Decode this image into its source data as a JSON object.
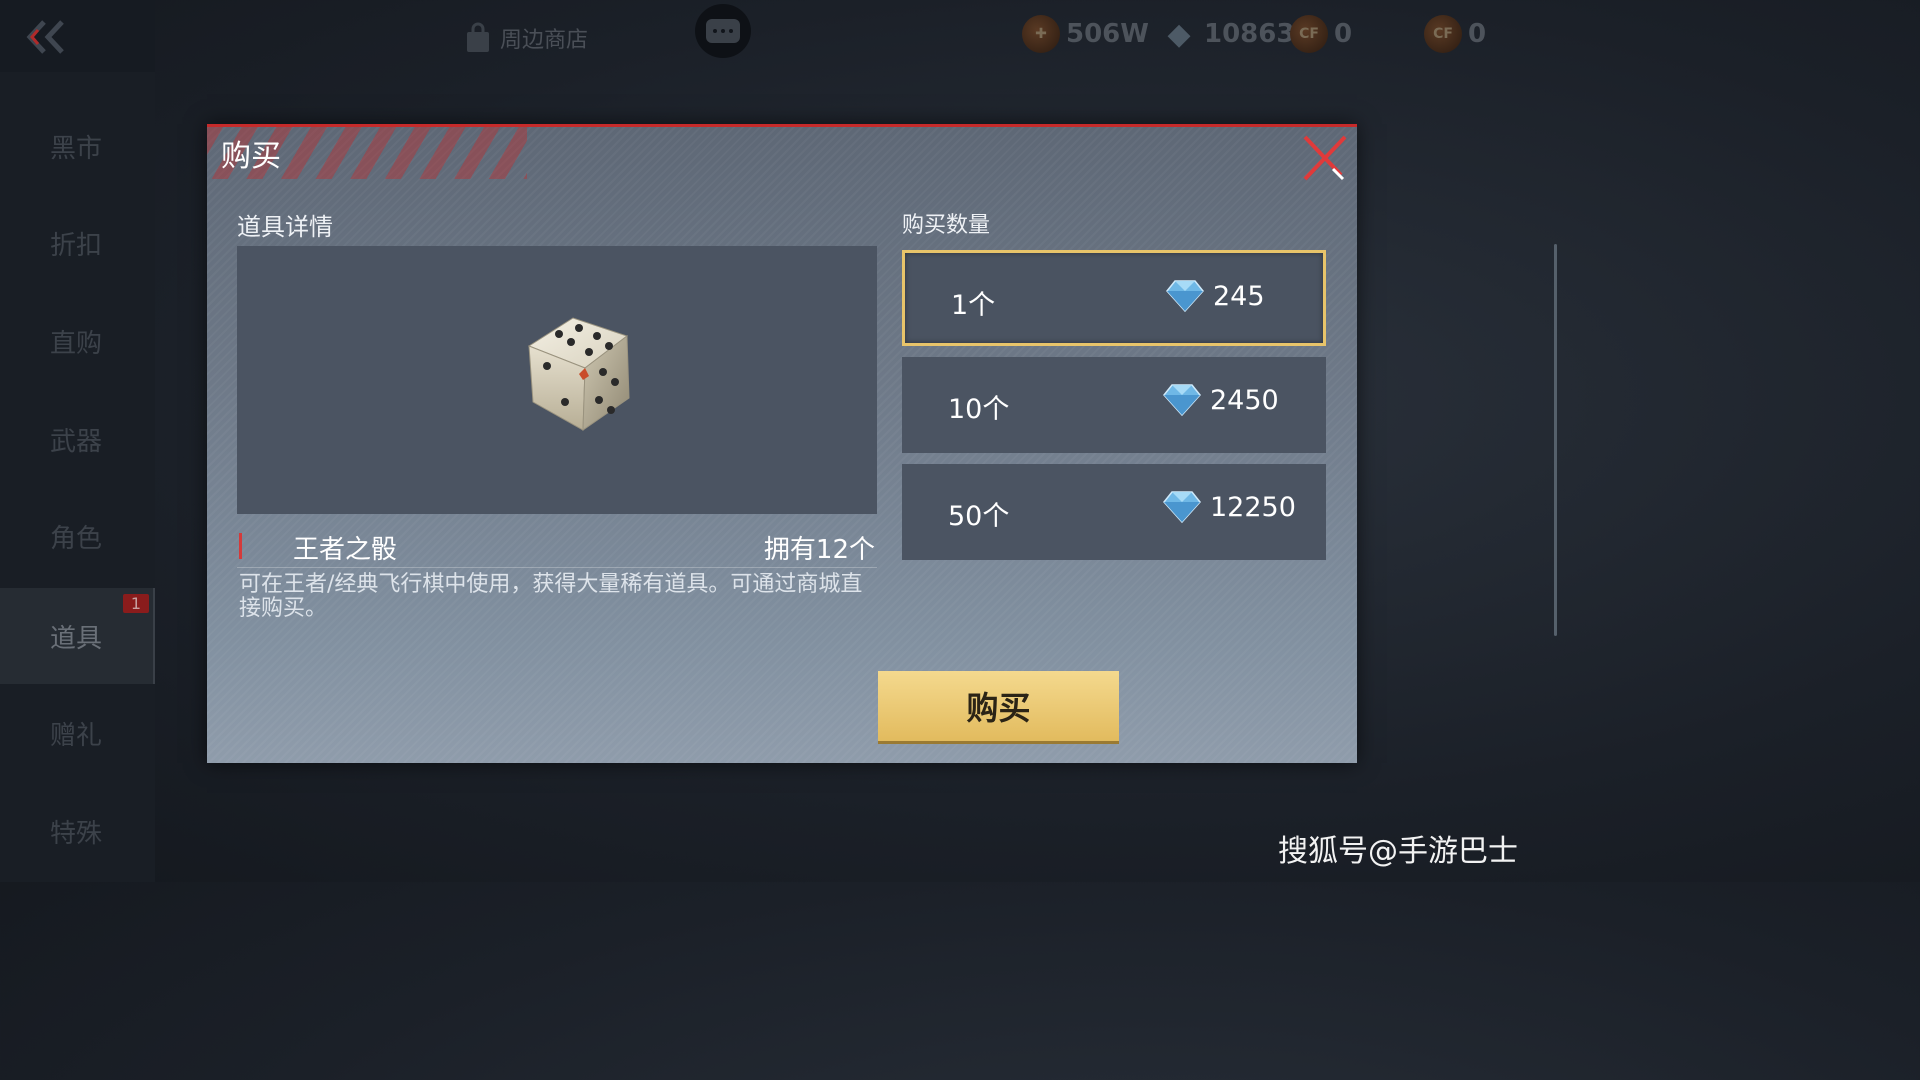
{
  "topbar": {
    "shop_label": "周边商店",
    "currencies": [
      {
        "icon": "gold-coin-icon",
        "value": "506W"
      },
      {
        "icon": "diamond-icon",
        "value": "10863"
      },
      {
        "icon": "cf-point-icon",
        "value": "0"
      },
      {
        "icon": "cf-coin-icon",
        "value": "0"
      }
    ]
  },
  "sidebar": {
    "items": [
      {
        "label": "黑市"
      },
      {
        "label": "折扣"
      },
      {
        "label": "直购"
      },
      {
        "label": "武器"
      },
      {
        "label": "角色"
      },
      {
        "label": "道具",
        "badge": "1"
      },
      {
        "label": "赠礼"
      },
      {
        "label": "特殊"
      }
    ],
    "active_index": 5
  },
  "modal": {
    "title": "购买",
    "details_label": "道具详情",
    "quantity_label": "购买数量",
    "item": {
      "name": "王者之骰",
      "owned": "拥有12个",
      "description": "可在王者/经典飞行棋中使用，获得大量稀有道具。可通过商城直接购买。"
    },
    "options": [
      {
        "qty": "1个",
        "price": "245",
        "selected": true
      },
      {
        "qty": "10个",
        "price": "2450",
        "selected": false
      },
      {
        "qty": "50个",
        "price": "12250",
        "selected": false
      }
    ],
    "buy_label": "购买"
  },
  "watermark": "搜狐号@手游巴士",
  "colors": {
    "accent_red": "#c62a2a",
    "selected_border": "#e8c46a",
    "buy_button": "#e8c46a"
  }
}
